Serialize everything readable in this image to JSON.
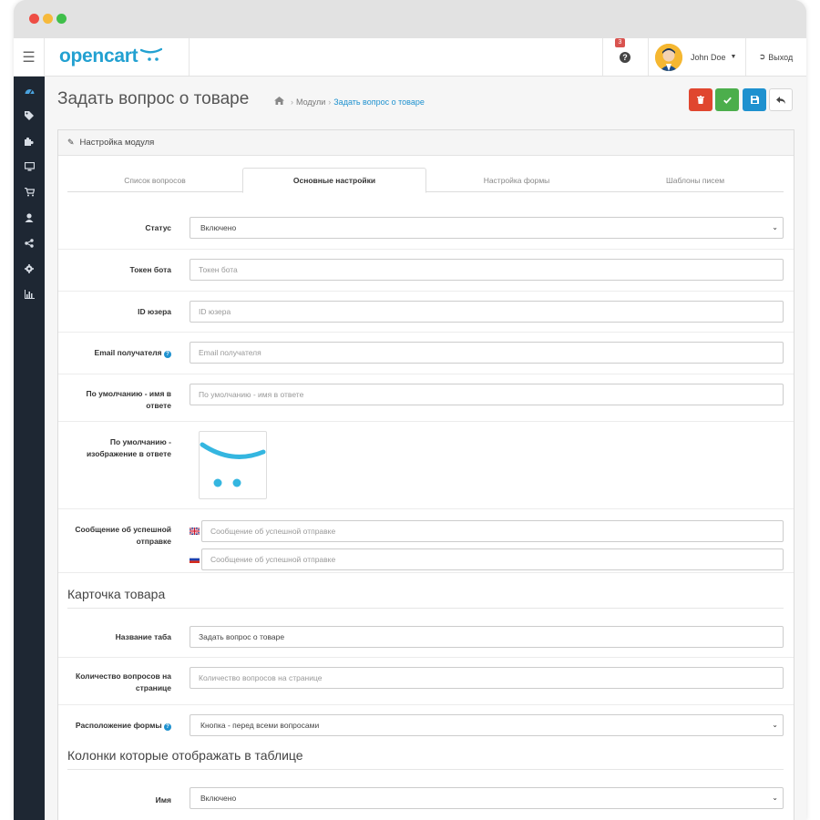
{
  "header": {
    "logo_text": "opencart",
    "notification_count": "3",
    "user_name": "John Doe",
    "logout_label": "Выход"
  },
  "page": {
    "title": "Задать вопрос о товаре",
    "breadcrumb": [
      "Модули",
      "Задать вопрос о товаре"
    ]
  },
  "panel": {
    "heading": "Настройка модуля",
    "tabs": [
      "Список вопросов",
      "Основные настройки",
      "Настройка формы",
      "Шаблоны писем"
    ],
    "active_tab": "Основные настройки"
  },
  "fields": {
    "status": {
      "label": "Статус",
      "value": "Включено"
    },
    "bot_token": {
      "label": "Токен бота",
      "placeholder": "Токен бота"
    },
    "user_id": {
      "label": "ID юзера",
      "placeholder": "ID юзера"
    },
    "email": {
      "label": "Email получателя",
      "placeholder": "Email получателя"
    },
    "default_name": {
      "label": "По умолчанию - имя в ответе",
      "placeholder": "По умолчанию - имя в ответе"
    },
    "default_image": {
      "label": "По умолчанию - изображение в ответе"
    },
    "success_message": {
      "label": "Сообщение об успешной отправке",
      "placeholder_en": "Сообщение об успешной отправке",
      "placeholder_ru": "Сообщение об успешной отправке"
    }
  },
  "product_card": {
    "title": "Карточка товара",
    "tab_name": {
      "label": "Название таба",
      "value": "Задать вопрос о товаре"
    },
    "per_page": {
      "label": "Количество вопросов на странице",
      "placeholder": "Количество вопросов на странице"
    },
    "form_position": {
      "label": "Расположение формы",
      "value": "Кнопка - перед всеми вопросами"
    }
  },
  "columns": {
    "title": "Колонки которые отображать в таблице",
    "name": {
      "label": "Имя",
      "value": "Включено"
    }
  },
  "colors": {
    "brand": "#23a1d1",
    "sidebar": "#1e2733",
    "delete": "#e0462f",
    "apply": "#4cae4c",
    "save": "#1e91cf"
  },
  "icons": {
    "delete": "trash-icon",
    "apply": "check-icon",
    "save": "floppy-icon",
    "back": "reply-icon"
  }
}
